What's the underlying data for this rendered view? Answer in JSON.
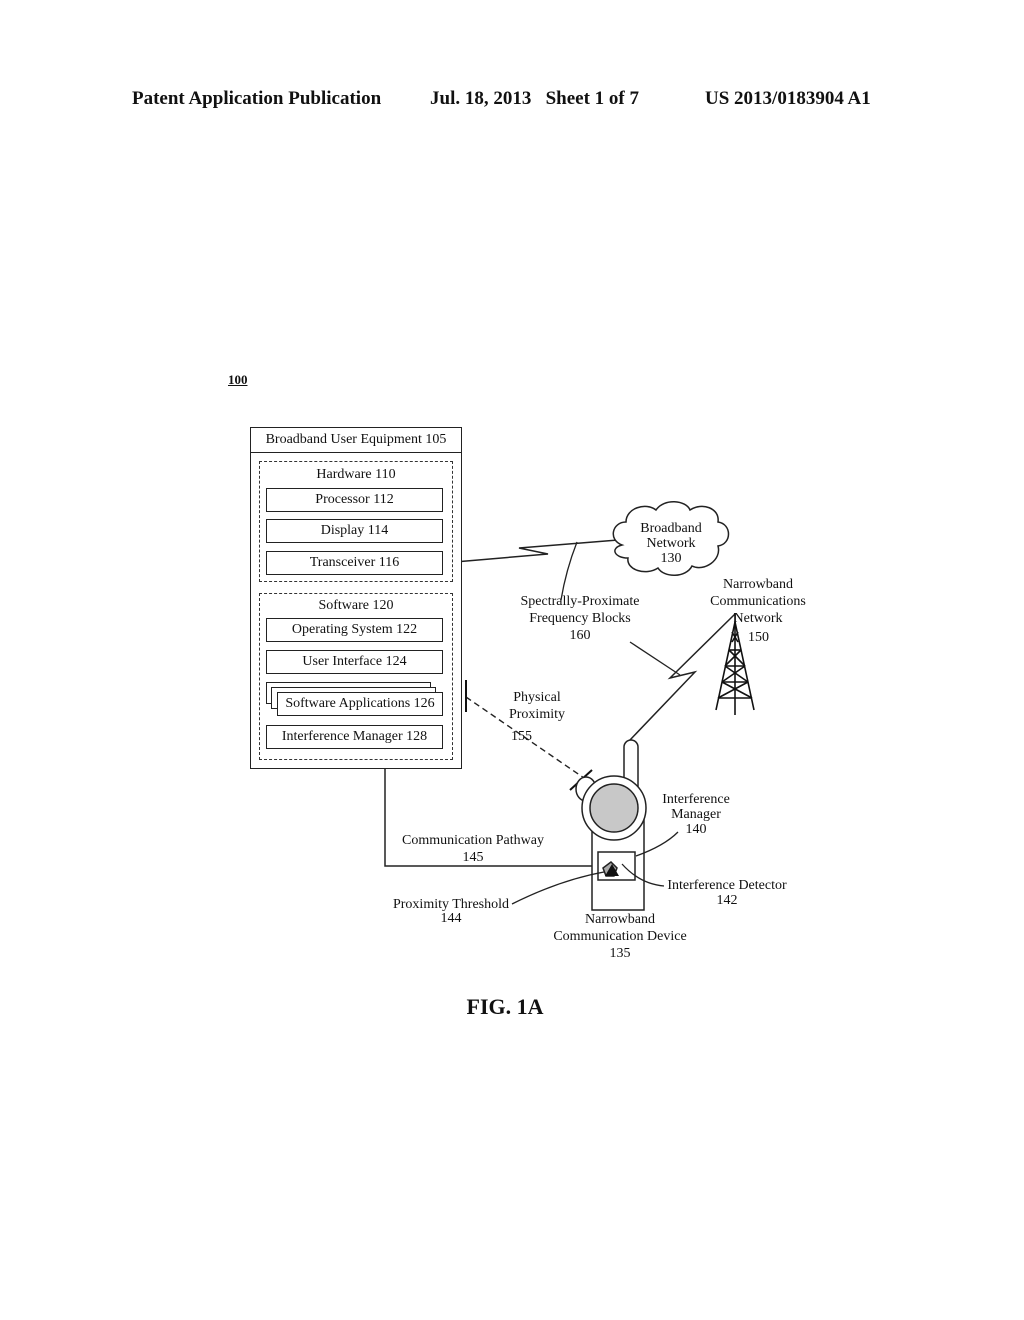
{
  "header": {
    "left": "Patent Application Publication",
    "middle": "Jul. 18, 2013   Sheet 1 of 7",
    "right": "US 2013/0183904 A1"
  },
  "figure_ref": "100",
  "ue": {
    "title": "Broadband User Equipment   105",
    "hardware": {
      "title": "Hardware  110",
      "items": [
        "Processor   112",
        "Display   114",
        "Transceiver   116"
      ]
    },
    "software": {
      "title": "Software  120",
      "items": [
        "Operating System   122",
        "User Interface   124",
        "Software Applications 126",
        "Interference Manager   128"
      ]
    }
  },
  "broadband_network": {
    "line1": "Broadband",
    "line2": "Network",
    "line3": "130"
  },
  "narrowband_network": {
    "line1": "Narrowband",
    "line2": "Communications",
    "line3": "Network",
    "line4": "150"
  },
  "freq_blocks": {
    "line1": "Spectrally-Proximate",
    "line2": "Frequency Blocks",
    "line3": "160"
  },
  "physical_proximity": {
    "line1": "Physical",
    "line2": "Proximity",
    "line3": "155"
  },
  "comm_pathway": {
    "line1": "Communication Pathway",
    "line2": "145"
  },
  "device_interference_manager": {
    "line1": "Interference",
    "line2": "Manager",
    "line3": "140"
  },
  "interference_detector": {
    "line1": "Interference Detector",
    "line2": "142"
  },
  "proximity_threshold": {
    "line1": "Proximity Threshold",
    "line2": "144"
  },
  "device": {
    "line1": "Narrowband",
    "line2": "Communication Device",
    "line3": "135"
  },
  "caption": "FIG. 1A"
}
